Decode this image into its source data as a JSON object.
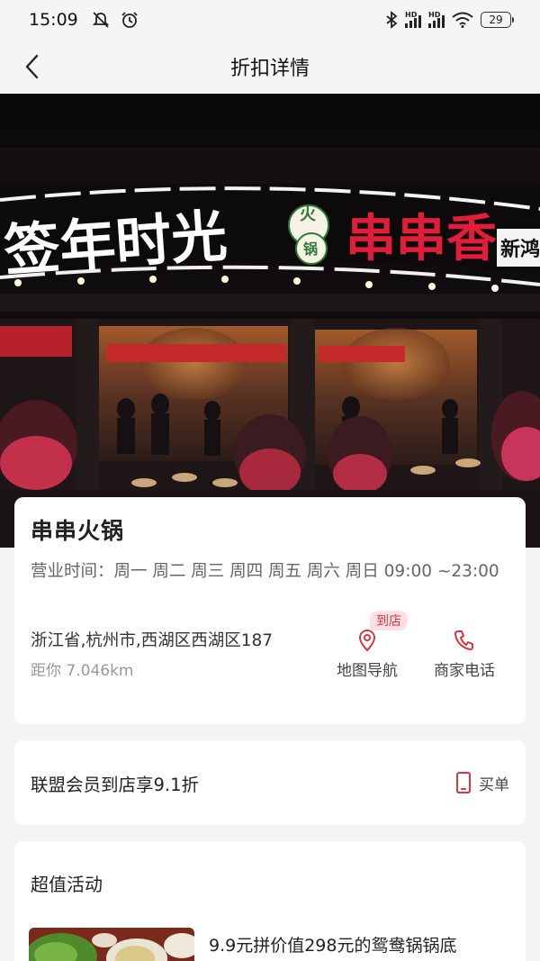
{
  "status_bar": {
    "time": "15:09",
    "battery": "29",
    "left_icons": [
      "mute-icon",
      "alarm-icon"
    ],
    "right_icons": [
      "bluetooth-icon",
      "hd-signal-icon",
      "hd-signal-icon",
      "wifi-icon",
      "battery-icon"
    ]
  },
  "nav": {
    "title": "折扣详情",
    "back_icon": "chevron-left-icon"
  },
  "hero": {
    "sign_left": "签年时光",
    "sign_badge_top": "火",
    "sign_badge_bottom": "锅",
    "sign_right": "串串香",
    "sign_edge": "新鸿"
  },
  "store": {
    "name": "串串火锅",
    "hours": "营业时间：周一 周二 周三 周四 周五 周六 周日 09:00 ~23:00",
    "address": "浙江省,杭州市,西湖区西湖区187",
    "distance": "距你 7.046km"
  },
  "actions": {
    "map_label": "地图导航",
    "map_badge": "到店",
    "phone_label": "商家电话"
  },
  "member": {
    "text": "联盟会员到店享9.1折",
    "buy_label": "买单"
  },
  "activity": {
    "title": "超值活动",
    "item_desc": "9.9元拼价值298元的鸳鸯锅锅底"
  },
  "colors": {
    "accent": "#d8373f",
    "background": "#f4f4f4",
    "card": "#ffffff"
  }
}
